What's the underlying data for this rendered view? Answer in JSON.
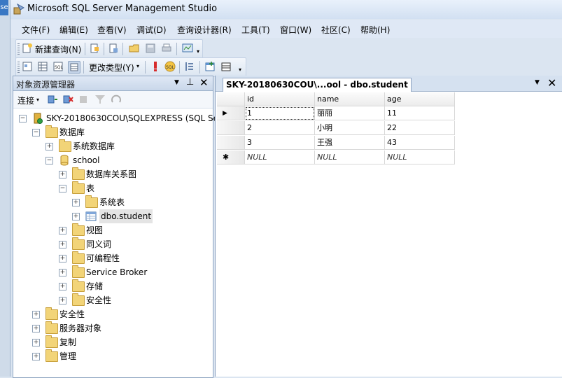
{
  "window": {
    "title": "Microsoft SQL Server Management Studio",
    "edge_tab": "se"
  },
  "menu": [
    "文件(F)",
    "编辑(E)",
    "查看(V)",
    "调试(D)",
    "查询设计器(R)",
    "工具(T)",
    "窗口(W)",
    "社区(C)",
    "帮助(H)"
  ],
  "toolbar1": {
    "new_query": "新建查询(N)"
  },
  "toolbar2": {
    "change_type": "更改类型(Y)"
  },
  "object_explorer": {
    "title": "对象资源管理器",
    "connect": "连接",
    "tree": [
      {
        "label": "SKY-20180630COU\\SQLEXPRESS (SQL Se",
        "level": 0,
        "expander": "−",
        "icon": "server-icon"
      },
      {
        "label": "数据库",
        "level": 1,
        "expander": "−",
        "icon": "folder-icon"
      },
      {
        "label": "系统数据库",
        "level": 2,
        "expander": "+",
        "icon": "folder-icon"
      },
      {
        "label": "school",
        "level": 2,
        "expander": "−",
        "icon": "database-icon"
      },
      {
        "label": "数据库关系图",
        "level": 3,
        "expander": "+",
        "icon": "folder-icon"
      },
      {
        "label": "表",
        "level": 3,
        "expander": "−",
        "icon": "folder-icon"
      },
      {
        "label": "系统表",
        "level": 4,
        "expander": "+",
        "icon": "folder-icon"
      },
      {
        "label": "dbo.student",
        "level": 4,
        "expander": "+",
        "icon": "table-icon"
      },
      {
        "label": "视图",
        "level": 3,
        "expander": "+",
        "icon": "folder-icon"
      },
      {
        "label": "同义词",
        "level": 3,
        "expander": "+",
        "icon": "folder-icon"
      },
      {
        "label": "可编程性",
        "level": 3,
        "expander": "+",
        "icon": "folder-icon"
      },
      {
        "label": "Service Broker",
        "level": 3,
        "expander": "+",
        "icon": "folder-icon"
      },
      {
        "label": "存储",
        "level": 3,
        "expander": "+",
        "icon": "folder-icon"
      },
      {
        "label": "安全性",
        "level": 3,
        "expander": "+",
        "icon": "folder-icon"
      },
      {
        "label": "安全性",
        "level": 1,
        "expander": "+",
        "icon": "folder-icon"
      },
      {
        "label": "服务器对象",
        "level": 1,
        "expander": "+",
        "icon": "folder-icon"
      },
      {
        "label": "复制",
        "level": 1,
        "expander": "+",
        "icon": "folder-icon"
      },
      {
        "label": "管理",
        "level": 1,
        "expander": "+",
        "icon": "folder-icon"
      }
    ]
  },
  "document": {
    "tab_title": "SKY-20180630COU\\...ool - dbo.student",
    "columns": [
      "id",
      "name",
      "age"
    ],
    "rows": [
      {
        "marker": "▶",
        "cells": [
          "1",
          "丽丽",
          "11"
        ]
      },
      {
        "marker": "",
        "cells": [
          "2",
          "小明",
          "22"
        ]
      },
      {
        "marker": "",
        "cells": [
          "3",
          "王强",
          "43"
        ]
      },
      {
        "marker": "✱",
        "cells": [
          "NULL",
          "NULL",
          "NULL"
        ]
      }
    ]
  },
  "colors": {
    "accent": "#3a78c4",
    "folder": "#f2d478",
    "chrome": "#dbe5f1"
  }
}
